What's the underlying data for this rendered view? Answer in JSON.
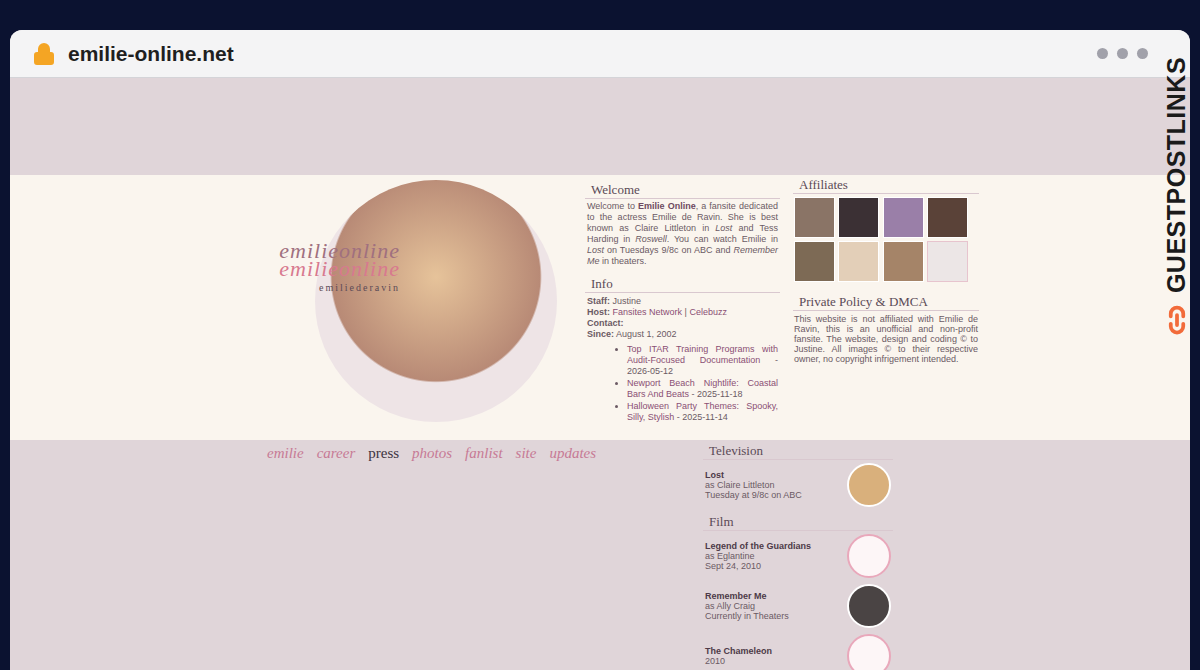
{
  "browser": {
    "url": "emilie-online.net",
    "watermark": "GUESTPOSTLINKS"
  },
  "header": {
    "logo_lines": [
      "emilieonline",
      "emilieonline"
    ],
    "logo_sub": "emiliederavin"
  },
  "welcome": {
    "title": "Welcome",
    "segments": [
      {
        "text": "Welcome to ",
        "style": "normal"
      },
      {
        "text": "Emilie Online",
        "style": "bold"
      },
      {
        "text": ", a fansite dedicated to the actress Emilie de Ravin. She is best known as Claire Littleton in ",
        "style": "normal"
      },
      {
        "text": "Lost",
        "style": "italic"
      },
      {
        "text": " and Tess Harding in ",
        "style": "normal"
      },
      {
        "text": "Roswell",
        "style": "italic"
      },
      {
        "text": ". You can watch Emilie in ",
        "style": "normal"
      },
      {
        "text": "Lost",
        "style": "italic"
      },
      {
        "text": " on Tuesdays 9/8c on ABC and ",
        "style": "normal"
      },
      {
        "text": "Remember Me",
        "style": "italic"
      },
      {
        "text": " in theaters.",
        "style": "normal"
      }
    ]
  },
  "info": {
    "title": "Info",
    "rows": [
      {
        "label": "Staff",
        "values": [
          "Justine"
        ],
        "linked": false
      },
      {
        "label": "Host",
        "values": [
          "Fansites Network",
          "Celebuzz"
        ],
        "linked": true
      },
      {
        "label": "Contact",
        "values": [],
        "linked": false
      },
      {
        "label": "Since",
        "values": [
          "August 1, 2002"
        ],
        "linked": false
      }
    ],
    "separator": " | ",
    "colon": ":",
    "links": [
      {
        "title": "Top ITAR Training Programs with Audit-Focused Documentation",
        "date": " - 2026-05-12"
      },
      {
        "title": "Newport Beach Nightlife: Coastal Bars And Beats",
        "date": " - 2025-11-18"
      },
      {
        "title": "Halloween Party Themes: Spooky, Silly, Stylish",
        "date": " - 2025-11-14"
      }
    ]
  },
  "affiliates": {
    "title": "Affiliates",
    "items": [
      {
        "kind": "photo",
        "color": "#8a7466"
      },
      {
        "kind": "photo",
        "color": "#3b3034"
      },
      {
        "kind": "photo",
        "color": "#9a7fa8"
      },
      {
        "kind": "photo",
        "color": "#5a4238"
      },
      {
        "kind": "photo",
        "color": "#7d6a55"
      },
      {
        "kind": "photo",
        "color": "#e3cfb8"
      },
      {
        "kind": "photo",
        "color": "#a58468"
      },
      {
        "kind": "logo",
        "color": "#ece6e6"
      }
    ]
  },
  "privacy": {
    "title": "Private Policy & DMCA",
    "text": "This website is not affiliated with Emilie de Ravin, this is an unofficial and non-profit fansite. The website, design and coding © to Justine. All images © to their respective owner, no copyright infrigement intended."
  },
  "nav": [
    {
      "label": "emilie",
      "selected": false
    },
    {
      "label": "career",
      "selected": false
    },
    {
      "label": "press",
      "selected": true
    },
    {
      "label": "photos",
      "selected": false
    },
    {
      "label": "fanlist",
      "selected": false
    },
    {
      "label": "site",
      "selected": false
    },
    {
      "label": "updates",
      "selected": false
    }
  ],
  "sidebar": [
    {
      "heading": "Television",
      "items": [
        {
          "title": "Lost",
          "role": "as Claire Littleton",
          "detail": "Tuesday at 9/8c on ABC",
          "kind": "photo"
        }
      ]
    },
    {
      "heading": "Film",
      "items": [
        {
          "title": "Legend of the Guardians",
          "role": "as Eglantine",
          "detail": "Sept 24, 2010",
          "kind": "logo"
        },
        {
          "title": "Remember Me",
          "role": "as Ally Craig",
          "detail": "Currently in Theaters",
          "kind": "photo"
        },
        {
          "title": "The Chameleon",
          "role": "",
          "detail": "2010",
          "kind": "logo"
        }
      ]
    }
  ]
}
